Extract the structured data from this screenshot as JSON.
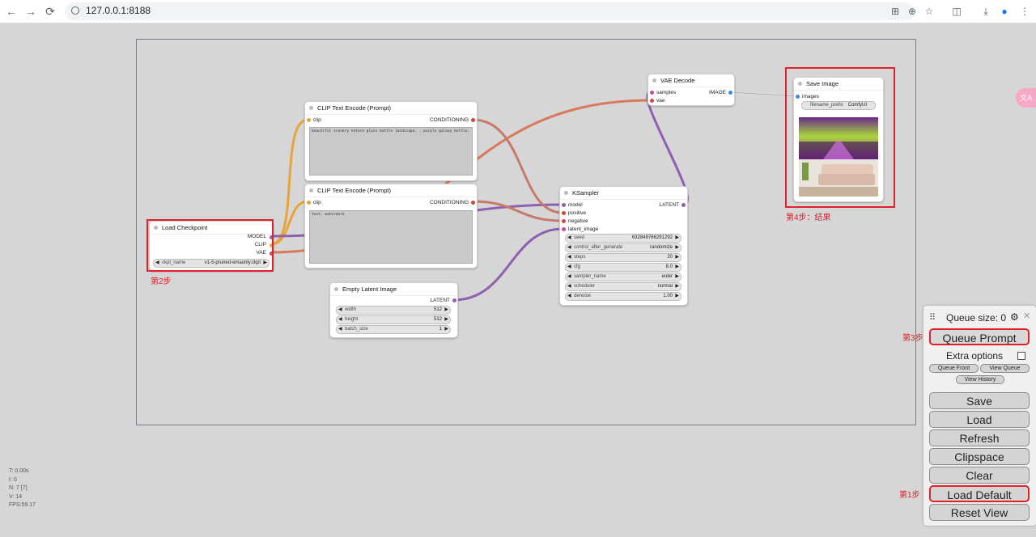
{
  "browser": {
    "url": "127.0.0.1:8188",
    "nav_back": "←",
    "nav_forward": "→",
    "nav_reload": "⟳"
  },
  "nodes": {
    "clip_pos": {
      "title": "CLIP Text Encode (Prompt)",
      "input": "clip",
      "output": "CONDITIONING",
      "text": "beautiful scenery nature glass bottle landscape, , purple galaxy bottle,"
    },
    "clip_neg": {
      "title": "CLIP Text Encode (Prompt)",
      "input": "clip",
      "output": "CONDITIONING",
      "text": "text, watermark"
    },
    "checkpoint": {
      "title": "Load Checkpoint",
      "outputs": [
        "MODEL",
        "CLIP",
        "VAE"
      ],
      "widget_label": "ckpt_name",
      "widget_value": "v1-5-pruned-emaonly.ckpt"
    },
    "latent": {
      "title": "Empty Latent Image",
      "output": "LATENT",
      "widgets": [
        {
          "label": "width",
          "value": "512"
        },
        {
          "label": "height",
          "value": "512"
        },
        {
          "label": "batch_size",
          "value": "1"
        }
      ]
    },
    "ksampler": {
      "title": "KSampler",
      "inputs": [
        "model",
        "positive",
        "negative",
        "latent_image"
      ],
      "output": "LATENT",
      "widgets": [
        {
          "label": "seed",
          "value": "632849766291292"
        },
        {
          "label": "control_after_generate",
          "value": "randomize"
        },
        {
          "label": "steps",
          "value": "20"
        },
        {
          "label": "cfg",
          "value": "8.0"
        },
        {
          "label": "sampler_name",
          "value": "euler"
        },
        {
          "label": "scheduler",
          "value": "normal"
        },
        {
          "label": "denoise",
          "value": "1.00"
        }
      ]
    },
    "vae": {
      "title": "VAE Decode",
      "inputs": [
        "samples",
        "vae"
      ],
      "output": "IMAGE"
    },
    "save": {
      "title": "Save Image",
      "input": "images",
      "widget_label": "filename_prefix",
      "widget_value": "ComfyUI"
    }
  },
  "annotations": {
    "step1": "第1步",
    "step2": "第2步",
    "step3": "第3步",
    "step4": "第4步：结果"
  },
  "menu": {
    "queue_size": "Queue size: 0",
    "queue_prompt": "Queue Prompt",
    "extra_options": "Extra options",
    "queue_front": "Queue Front",
    "view_queue": "View Queue",
    "view_history": "View History",
    "save": "Save",
    "load": "Load",
    "refresh": "Refresh",
    "clipspace": "Clipspace",
    "clear": "Clear",
    "load_default": "Load Default",
    "reset_view": "Reset View"
  },
  "stats": {
    "t": "T: 0.00s",
    "i": "I: 0",
    "n": "N: 7 [7]",
    "v": "V: 14",
    "fps": "FPS:59.17"
  },
  "colors": {
    "annotation_red": "#e0202a",
    "link_clip": "#e8a33a",
    "link_model": "#8f5fb0",
    "link_conditioning": "#c87a6a",
    "link_vae": "#d9785a"
  }
}
